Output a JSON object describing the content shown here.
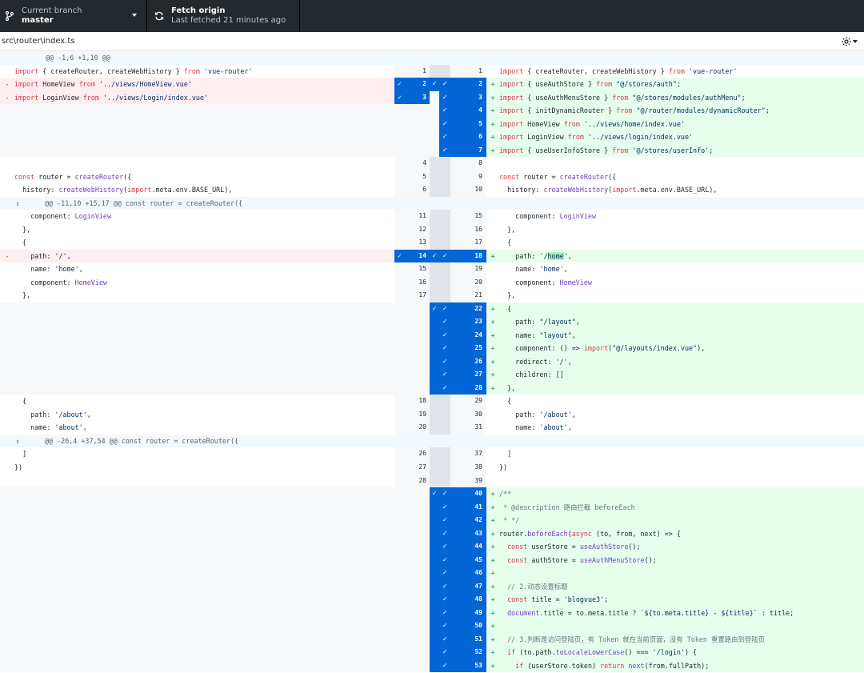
{
  "toolbar": {
    "branch_title": "Current branch",
    "branch_value": "master",
    "fetch_title": "Fetch origin",
    "fetch_value": "Last fetched 21 minutes ago"
  },
  "file": {
    "path": "src\\router\\index.ts"
  },
  "hunks": [
    "@@ -1,6 +1,10 @@",
    "@@ -11,10 +15,17 @@ const router = createRouter({",
    "@@ -26,4 +37,54 @@ const router = createRouter({"
  ],
  "colors": {
    "toolbar_bg": "#24292e",
    "selected_line": "#0366d6",
    "deletion_bg": "#ffeef0",
    "addition_bg": "#e6ffed",
    "hunk_bg": "#f1f8ff"
  }
}
